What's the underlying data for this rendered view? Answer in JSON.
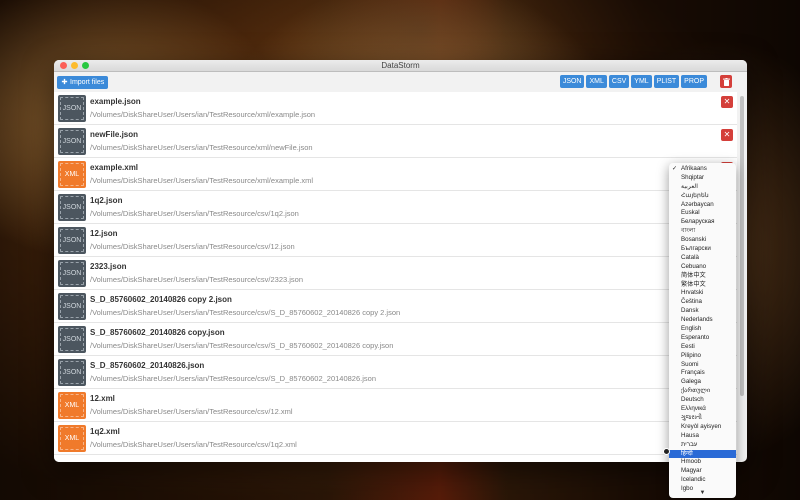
{
  "app": {
    "title": "DataStorm"
  },
  "toolbar": {
    "import_label": "Import files",
    "formats": [
      "JSON",
      "XML",
      "CSV",
      "YML",
      "PLIST",
      "PROP"
    ]
  },
  "files": [
    {
      "type": "JSON",
      "name": "example.json",
      "path": "/Volumes/DiskShareUser/Users/ian/TestResource/xml/example.json"
    },
    {
      "type": "JSON",
      "name": "newFile.json",
      "path": "/Volumes/DiskShareUser/Users/ian/TestResource/xml/newFile.json"
    },
    {
      "type": "XML",
      "name": "example.xml",
      "path": "/Volumes/DiskShareUser/Users/ian/TestResource/xml/example.xml"
    },
    {
      "type": "JSON",
      "name": "1q2.json",
      "path": "/Volumes/DiskShareUser/Users/ian/TestResource/csv/1q2.json"
    },
    {
      "type": "JSON",
      "name": "12.json",
      "path": "/Volumes/DiskShareUser/Users/ian/TestResource/csv/12.json"
    },
    {
      "type": "JSON",
      "name": "2323.json",
      "path": "/Volumes/DiskShareUser/Users/ian/TestResource/csv/2323.json"
    },
    {
      "type": "JSON",
      "name": "S_D_85760602_20140826 copy 2.json",
      "path": "/Volumes/DiskShareUser/Users/ian/TestResource/csv/S_D_85760602_20140826 copy 2.json"
    },
    {
      "type": "JSON",
      "name": "S_D_85760602_20140826 copy.json",
      "path": "/Volumes/DiskShareUser/Users/ian/TestResource/csv/S_D_85760602_20140826 copy.json"
    },
    {
      "type": "JSON",
      "name": "S_D_85760602_20140826.json",
      "path": "/Volumes/DiskShareUser/Users/ian/TestResource/csv/S_D_85760602_20140826.json"
    },
    {
      "type": "XML",
      "name": "12.xml",
      "path": "/Volumes/DiskShareUser/Users/ian/TestResource/csv/12.xml"
    },
    {
      "type": "XML",
      "name": "1q2.xml",
      "path": "/Volumes/DiskShareUser/Users/ian/TestResource/csv/1q2.xml"
    }
  ],
  "languages": {
    "selected": "Afrikaans",
    "highlighted": "हिन्दी",
    "items": [
      "Afrikaans",
      "Shqiptar",
      "العربية",
      "Հայերեն",
      "Azərbaycan",
      "Euskal",
      "Беларуская",
      "বাংলা",
      "Bosanski",
      "Български",
      "Català",
      "Cebuano",
      "简体中文",
      "繁体中文",
      "Hrvatski",
      "Čeština",
      "Dansk",
      "Nederlands",
      "English",
      "Esperanto",
      "Eesti",
      "Pilipino",
      "Suomi",
      "Français",
      "Galega",
      "ქართული",
      "Deutsch",
      "Ελληνικά",
      "ગુજરાતી",
      "Kreyòl ayisyen",
      "Hausa",
      "עברית",
      "हिन्दी",
      "Hmoob",
      "Magyar",
      "Icelandic",
      "Igbo"
    ]
  },
  "icons": {
    "import": "plus-icon",
    "trash": "trash-icon",
    "delete": "close-icon",
    "more": "chevron-down-icon"
  },
  "colors": {
    "accent": "#3b8ad9",
    "danger": "#d43f3a",
    "json_thumb": "#4c565f",
    "xml_thumb": "#f07a2b",
    "selection": "#2a6ad6"
  }
}
